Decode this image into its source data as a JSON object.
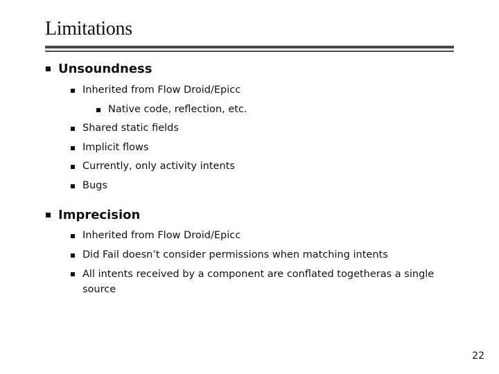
{
  "slide": {
    "title": "Limitations",
    "page_number": "22",
    "sections": [
      {
        "heading": "Unsoundness",
        "items": [
          {
            "text": "Inherited from Flow Droid/Epicc",
            "subitems": [
              "Native code, reflection, etc."
            ]
          },
          {
            "text": "Shared static fields"
          },
          {
            "text": "Implicit flows"
          },
          {
            "text": "Currently, only activity intents"
          },
          {
            "text": "Bugs"
          }
        ]
      },
      {
        "heading": "Imprecision",
        "items": [
          {
            "text": "Inherited from Flow Droid/Epicc"
          },
          {
            "text": "Did Fail doesn’t consider permissions when matching intents"
          },
          {
            "text": "All intents received by a component are conflated togetheras a single source"
          }
        ]
      }
    ]
  }
}
